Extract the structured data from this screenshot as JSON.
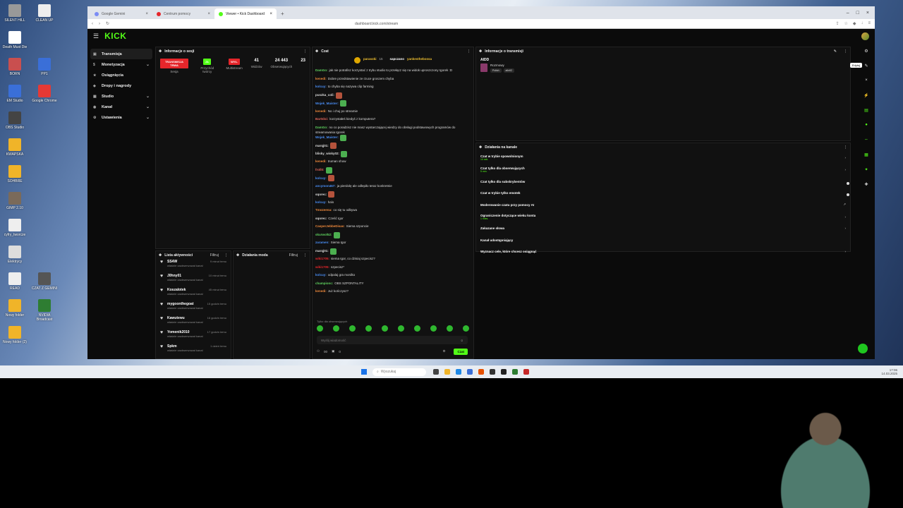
{
  "desktop": {
    "icons": [
      "SILENT HILL",
      "Death Must Die",
      "BORN",
      "EM Studio",
      "OBS Studio",
      "KWAPSKA",
      "SOHBRE",
      "GIMP 2.10",
      "cyfry_tworcze",
      "Elektrycy",
      "READ",
      "Nowy folder",
      "Nowy folder (2)",
      "CLEAN UP",
      "PP1",
      "Google Chrome",
      "CZAT Z GEMINI",
      "NVIDIA Broadcast"
    ]
  },
  "browser": {
    "tabs": [
      {
        "label": "Google Gemini"
      },
      {
        "label": "Centrum pomocy"
      },
      {
        "label": "Viewer • Kick Dashboard"
      }
    ],
    "url": "dashboard.kick.com/stream"
  },
  "kick": {
    "logo": "KICK",
    "sidebar": [
      {
        "label": "Transmisja",
        "active": true
      },
      {
        "label": "Monetyzacja",
        "chev": true
      },
      {
        "label": "Osiągnięcia"
      },
      {
        "label": "Dropy i nagrody"
      },
      {
        "label": "Studio",
        "chev": true
      },
      {
        "label": "Kanał",
        "chev": true
      },
      {
        "label": "Ustawienia",
        "chev": true
      }
    ],
    "session": {
      "title": "Informacje o sesji",
      "stats": [
        {
          "badge": "TRANSMISJA TRWA",
          "badge_color": "#e5262b",
          "label": "Sesja"
        },
        {
          "badge": "ZŁ",
          "badge_color": "#53fc18",
          "label": "Przychód twórcy"
        },
        {
          "badge": "WYŁ.",
          "badge_color": "#e5262b",
          "label": "Multistream"
        },
        {
          "num": "41",
          "label": "Widzów"
        },
        {
          "num": "24 443",
          "label": "Obserwujących"
        },
        {
          "num": "23",
          "label": ""
        }
      ]
    },
    "activity": {
      "title": "Lista aktywności",
      "filter": "Filtruj",
      "items": [
        {
          "name": "SS4W",
          "sub": "właśnie zaobserwował kanał",
          "time": "9 minut temu"
        },
        {
          "name": "J0hny01",
          "sub": "właśnie zaobserwował kanał",
          "time": "10 minut temu"
        },
        {
          "name": "Koszalotek",
          "sub": "właśnie zaobserwował kanał",
          "time": "45 minut temu"
        },
        {
          "name": "mygoonthegoat",
          "sub": "właśnie zaobserwował kanał",
          "time": "15 godzin temu"
        },
        {
          "name": "Kawutewu",
          "sub": "właśnie zaobserwował kanał",
          "time": "16 godzin temu"
        },
        {
          "name": "Yomenik2010",
          "sub": "właśnie zaobserwował kanał",
          "time": "17 godzin temu"
        },
        {
          "name": "Spkm",
          "sub": "właśnie zaobserwował kanał",
          "time": "1 dzień temu"
        }
      ]
    },
    "mod": {
      "title": "Działania moda",
      "filter": "Filtruj"
    },
    "chat": {
      "title": "Czat",
      "top_left": "parasoki",
      "top_left_sub": "15",
      "top_right": "sapczano",
      "top_right2": "yankesthebossa",
      "messages": [
        {
          "user": "DamGo:",
          "color": "#5fd35f",
          "text": "jak nie potrafisz korzystać z trybu studio to przełącz się na widok uproszczony Igorek :D"
        },
        {
          "user": "kenedi:",
          "color": "#f08a3c",
          "text": "Dobre przedstawienie ze rzuce groszem chyba"
        },
        {
          "user": "kolcuy:",
          "color": "#4a8ef5",
          "text": "to chyba się nazywa clip farming"
        },
        {
          "user": "puszka_coli:",
          "color": "#dddddd",
          "text": ""
        },
        {
          "user": "Wojek_Maister:",
          "color": "#4a8ef5",
          "text": ""
        },
        {
          "user": "kenedi:",
          "color": "#f08a3c",
          "text": "No i chuj po streamie"
        },
        {
          "user": "Bar0doi:",
          "color": "#e0645a",
          "text": "korzystałeś kiedyś z komputera?"
        },
        {
          "user": "DamGo:",
          "color": "#5fd35f",
          "text": "no co poradzisz nie masz wystarczającej wiedzy do obsługi podstawowych programów do streamowania Igorek"
        },
        {
          "user": "Wojek_Maister:",
          "color": "#4a8ef5",
          "text": ""
        },
        {
          "user": "marqj01:",
          "color": "#dddddd",
          "text": ""
        },
        {
          "user": "blisky_wisky02:",
          "color": "#dddddd",
          "text": ""
        },
        {
          "user": "kenedi:",
          "color": "#f08a3c",
          "text": "truman show"
        },
        {
          "user": "froll0:",
          "color": "#e0645a",
          "text": ""
        },
        {
          "user": "kolcuy:",
          "color": "#4a8ef5",
          "text": ""
        },
        {
          "user": "ancymon467:",
          "color": "#4a8ef5",
          "text": "ja pierdolę ale odlepiło teraz konkretnie"
        },
        {
          "user": "sqorec:",
          "color": "#dddddd",
          "text": ""
        },
        {
          "user": "kolcuy:",
          "color": "#4a8ef5",
          "text": "halo"
        },
        {
          "user": "Tmozeena:",
          "color": "#f08a3c",
          "text": "co się tu odbywa"
        },
        {
          "user": "sqorec:",
          "color": "#dddddd",
          "text": "Cześć Igor"
        },
        {
          "user": "CasperJebbeDisas:",
          "color": "#f08a3c",
          "text": "Siema szponcie"
        },
        {
          "user": "skurwol52:",
          "color": "#5fd35f",
          "text": ""
        },
        {
          "user": "zaramen:",
          "color": "#4a8ef5",
          "text": "Siema Igor"
        },
        {
          "user": "marqj01:",
          "color": "#dddddd",
          "text": ""
        },
        {
          "user": "wiki1705:",
          "color": "#e5262b",
          "text": "siema Igor, co dzisiaj szpecisz?"
        },
        {
          "user": "wiki1705:",
          "color": "#e5262b",
          "text": "szpecisz*"
        },
        {
          "user": "kolcuy:",
          "color": "#4a8ef5",
          "text": "odpalaj gra mordko"
        },
        {
          "user": "championc:",
          "color": "#5fd35f",
          "text": "OBS SZPONTALITY"
        },
        {
          "user": "kenedi:",
          "color": "#f08a3c",
          "text": "Już kończysz?"
        }
      ],
      "followers_only": "Tylko dla obserwujących",
      "input_placeholder": "Wyślij wiadomość",
      "foot_a": "00",
      "foot_b": "0",
      "send": "Czat"
    },
    "stream_info": {
      "title": "Informacje o transmisji",
      "tag": "AIDD",
      "category": "Rozmowy",
      "chip1": "Polish",
      "chip2": "aiInfi2",
      "edit_tooltip": "Edytuj"
    },
    "channel_actions": {
      "title": "Działania na kanale",
      "items": [
        {
          "label": "Czat w trybie spowolnionym",
          "sub": "10 sek.",
          "right": "chevron"
        },
        {
          "label": "Czat tylko dla obserwujących",
          "sub": "5 min.",
          "right": "chevron"
        },
        {
          "label": "Czat tylko dla subskrybentów",
          "sub": "",
          "right": "toggle"
        },
        {
          "label": "Czat w trybie tylko emotek",
          "sub": "",
          "right": "toggle"
        },
        {
          "label": "Moderowanie czatu przy pomocy AI",
          "sub": "",
          "right": "external"
        },
        {
          "label": "Ograniczenie dotyczące wieku konta",
          "sub": "1 mies.",
          "right": "chevron"
        },
        {
          "label": "Zakazane słowa",
          "sub": "",
          "right": "chevron"
        },
        {
          "label": "Kanał udostępniający",
          "sub": "",
          "right": ""
        },
        {
          "label": "Wyznacz cele, które chcesz osiągnąć",
          "sub": "",
          "right": "chevron"
        }
      ]
    }
  },
  "taskbar": {
    "search": "Wyszukaj",
    "time": "17:06",
    "date": "14.03.2025"
  }
}
